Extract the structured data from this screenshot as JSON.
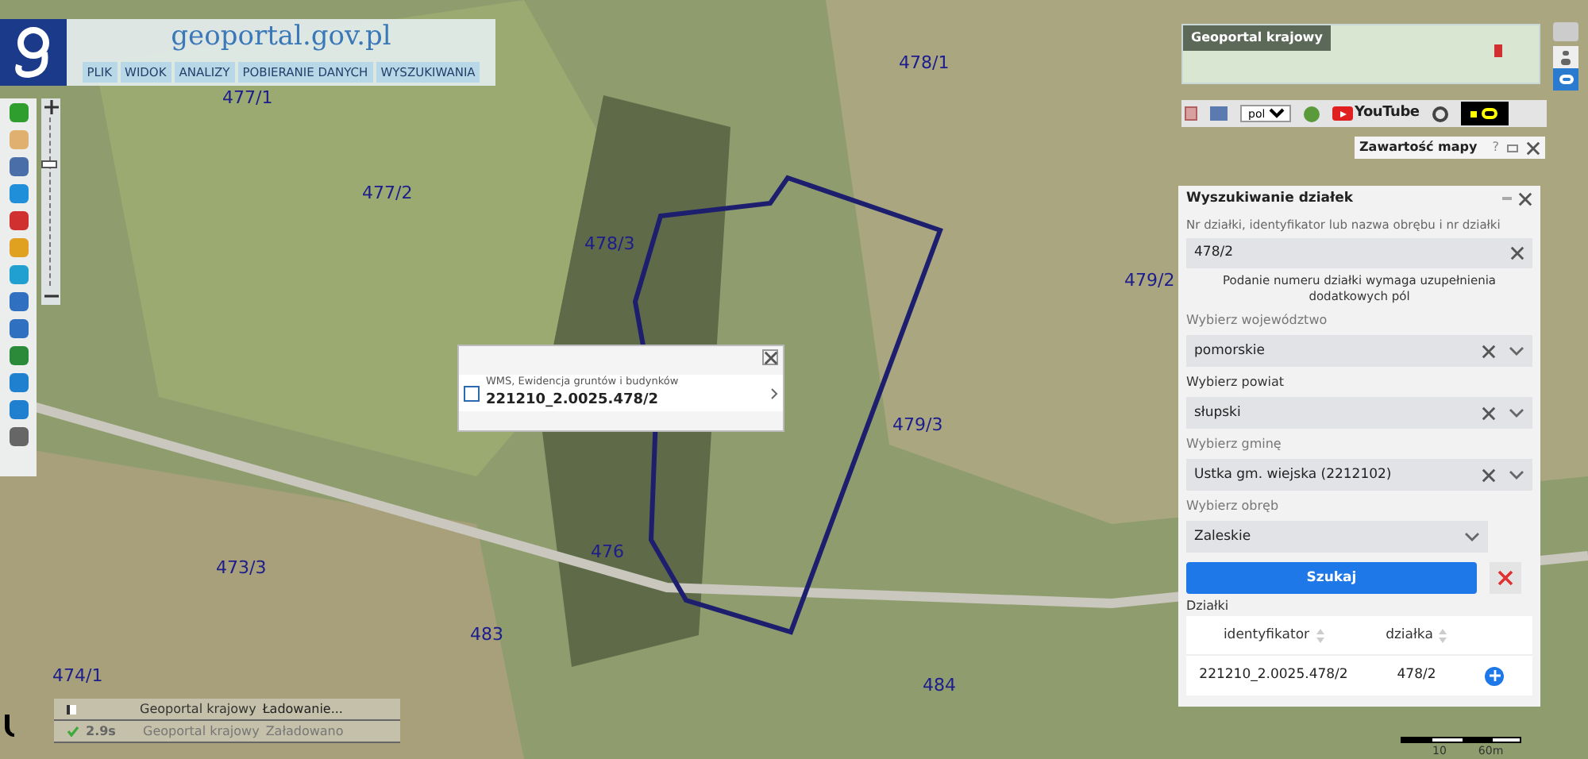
{
  "header": {
    "logo": "geoportal.gov.pl",
    "menu": [
      "PLIK",
      "WIDOK",
      "ANALIZY",
      "POBIERANIE DANYCH",
      "WYSZUKIWANIA"
    ]
  },
  "map": {
    "parcel_labels": [
      "477/1",
      "477/2",
      "478/1",
      "478/3",
      "479/2",
      "479/3",
      "473/3",
      "476",
      "483",
      "474/1",
      "484"
    ],
    "scale_labels": [
      "10",
      "60m"
    ],
    "zoom": {
      "level": 0.75
    }
  },
  "popup": {
    "layer": "WMS, Ewidencja gruntów i budynków",
    "id": "221210_2.0025.478/2"
  },
  "overview": {
    "title": "Geoportal krajowy"
  },
  "toolbar": {
    "language": "pol",
    "video_brand": "YouTube"
  },
  "map_contents": {
    "title": "Zawartość mapy",
    "help": "?"
  },
  "search": {
    "title": "Wyszukiwanie działek",
    "query_label": "Nr działki, identyfikator lub nazwa obrębu i nr działki",
    "query": "478/2",
    "note": "Podanie numeru działki wymaga uzupełnienia dodatkowych pól",
    "selects": [
      {
        "label": "Wybierz województwo",
        "value": "pomorskie",
        "clearable": true
      },
      {
        "label": "Wybierz powiat",
        "value": "słupski",
        "clearable": true
      },
      {
        "label": "Wybierz gminę",
        "value": "Ustka gm. wiejska (2212102)",
        "clearable": true
      },
      {
        "label": "Wybierz obręb",
        "value": "Zaleskie",
        "clearable": false
      }
    ],
    "search_button": "Szukaj",
    "results_label": "Działki",
    "columns": [
      "identyfikator",
      "działka"
    ],
    "rows": [
      {
        "id": "221210_2.0025.478/2",
        "parcel": "478/2"
      }
    ]
  },
  "status": [
    {
      "kind": "loading",
      "source": "Geoportal krajowy",
      "message": "Ładowanie..."
    },
    {
      "kind": "done",
      "time": "2.9s",
      "source": "Geoportal krajowy",
      "message": "Załadowano"
    }
  ]
}
